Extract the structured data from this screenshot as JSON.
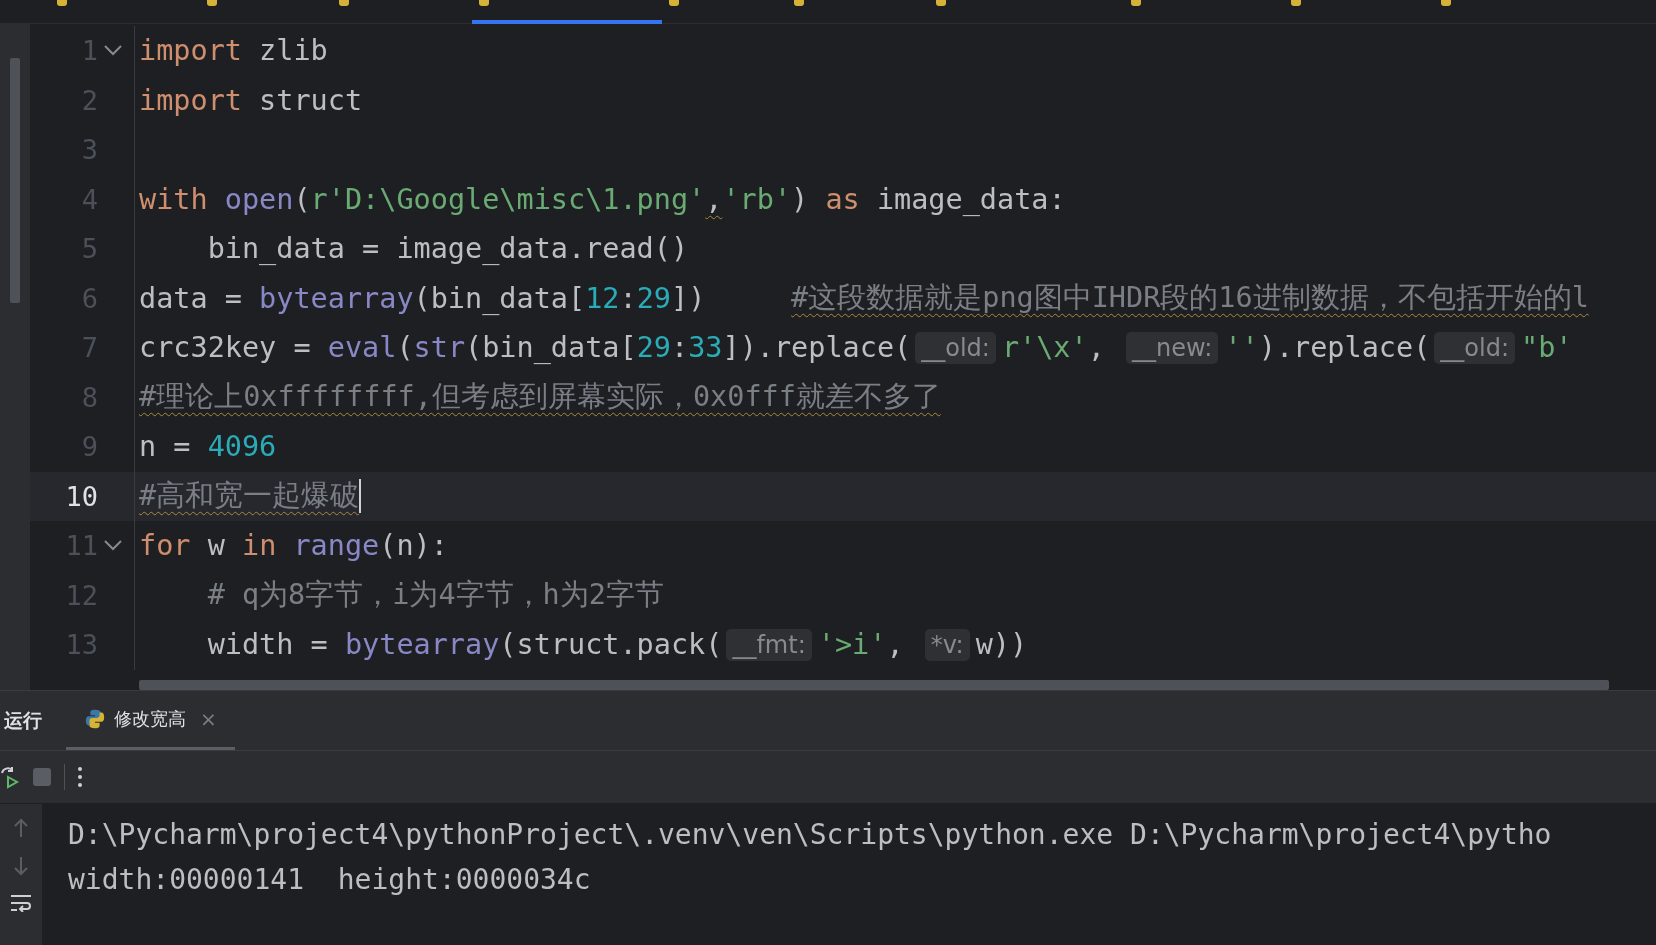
{
  "editor_tabs": [
    {
      "selected": false
    },
    {
      "selected": false
    },
    {
      "selected": false
    },
    {
      "selected": true
    },
    {
      "selected": false
    },
    {
      "selected": false
    },
    {
      "selected": false
    },
    {
      "selected": false
    },
    {
      "selected": false
    },
    {
      "selected": false
    }
  ],
  "code_lines": [
    {
      "number": "1",
      "current": false,
      "foldable": true,
      "tokens": [
        {
          "kind": "keyword",
          "text": "import"
        },
        {
          "kind": "plain",
          "text": " zlib"
        }
      ]
    },
    {
      "number": "2",
      "current": false,
      "foldable": false,
      "tokens": [
        {
          "kind": "keyword",
          "text": "import"
        },
        {
          "kind": "plain",
          "text": " struct"
        }
      ]
    },
    {
      "number": "3",
      "current": false,
      "foldable": false
    },
    {
      "number": "4",
      "current": false,
      "foldable": false,
      "tokens": [
        {
          "kind": "keyword",
          "text": "with "
        },
        {
          "kind": "builtin",
          "text": "open"
        },
        {
          "kind": "plain",
          "text": "("
        },
        {
          "kind": "string",
          "text": "r'D:\\Google\\misc\\1.png'"
        },
        {
          "kind": "warn",
          "text": ","
        },
        {
          "kind": "string",
          "text": "'rb'"
        },
        {
          "kind": "plain",
          "text": ") "
        },
        {
          "kind": "keyword",
          "text": "as"
        },
        {
          "kind": "plain",
          "text": " image_data:"
        }
      ]
    },
    {
      "number": "5",
      "current": false,
      "foldable": false,
      "tokens": [
        {
          "kind": "plain",
          "text": "    bin_data = image_data.read()"
        }
      ]
    },
    {
      "number": "6",
      "current": false,
      "foldable": false,
      "tokens": [
        {
          "kind": "plain",
          "text": "data = "
        },
        {
          "kind": "builtin",
          "text": "bytearray"
        },
        {
          "kind": "plain",
          "text": "(bin_data["
        },
        {
          "kind": "number",
          "text": "12"
        },
        {
          "kind": "plain",
          "text": ":"
        },
        {
          "kind": "number",
          "text": "29"
        },
        {
          "kind": "plain",
          "text": "])     "
        },
        {
          "kind": "comment-warn",
          "text": "#这段数据就是png图中IHDR段的16进制数据，不包括开始的l"
        }
      ]
    },
    {
      "number": "7",
      "current": false,
      "foldable": false,
      "tokens": [
        {
          "kind": "plain",
          "text": "crc32key = "
        },
        {
          "kind": "builtin",
          "text": "eval"
        },
        {
          "kind": "plain",
          "text": "("
        },
        {
          "kind": "builtin",
          "text": "str"
        },
        {
          "kind": "plain",
          "text": "(bin_data["
        },
        {
          "kind": "number",
          "text": "29"
        },
        {
          "kind": "plain",
          "text": ":"
        },
        {
          "kind": "number",
          "text": "33"
        },
        {
          "kind": "plain",
          "text": "]).replace("
        },
        {
          "kind": "hint",
          "text": "__old:"
        },
        {
          "kind": "string",
          "text": "r'\\x'"
        },
        {
          "kind": "plain",
          "text": ", "
        },
        {
          "kind": "hint",
          "text": "__new:"
        },
        {
          "kind": "string",
          "text": "''"
        },
        {
          "kind": "plain",
          "text": ").replace("
        },
        {
          "kind": "hint",
          "text": "__old:"
        },
        {
          "kind": "string",
          "text": "\"b'"
        }
      ]
    },
    {
      "number": "8",
      "current": false,
      "foldable": false,
      "tokens": [
        {
          "kind": "comment-warn",
          "text": "#理论上0xffffffff,但考虑到屏幕实际，0x0fff就差不多了"
        }
      ]
    },
    {
      "number": "9",
      "current": false,
      "foldable": false,
      "tokens": [
        {
          "kind": "plain",
          "text": "n = "
        },
        {
          "kind": "number",
          "text": "4096"
        }
      ]
    },
    {
      "number": "10",
      "current": true,
      "foldable": false,
      "tokens": [
        {
          "kind": "comment-warn",
          "text": "#高和宽一起爆破"
        }
      ]
    },
    {
      "number": "11",
      "current": false,
      "foldable": true,
      "tokens": [
        {
          "kind": "keyword",
          "text": "for"
        },
        {
          "kind": "plain",
          "text": " w "
        },
        {
          "kind": "keyword",
          "text": "in "
        },
        {
          "kind": "builtin",
          "text": "range"
        },
        {
          "kind": "plain",
          "text": "(n):"
        }
      ]
    },
    {
      "number": "12",
      "current": false,
      "foldable": false,
      "tokens": [
        {
          "kind": "comment",
          "text": "    # q为8字节，i为4字节，h为2字节"
        }
      ]
    },
    {
      "number": "13",
      "current": false,
      "foldable": false,
      "tokens": [
        {
          "kind": "plain",
          "text": "    width = "
        },
        {
          "kind": "builtin",
          "text": "bytearray"
        },
        {
          "kind": "plain",
          "text": "(struct.pack("
        },
        {
          "kind": "hint",
          "text": "__fmt:"
        },
        {
          "kind": "string",
          "text": "'>i'"
        },
        {
          "kind": "plain",
          "text": ", "
        },
        {
          "kind": "hint",
          "text": "*v:"
        },
        {
          "kind": "plain",
          "text": "w))"
        }
      ]
    }
  ],
  "run_panel": {
    "title": "运行",
    "tabs": [
      {
        "label": "修改宽高",
        "selected": true,
        "close": "×"
      }
    ],
    "output": [
      "D:\\Pycharm\\project4\\pythonProject\\.venv\\ven\\Scripts\\python.exe D:\\Pycharm\\project4\\pytho",
      "width:00000141  height:0000034c"
    ]
  }
}
